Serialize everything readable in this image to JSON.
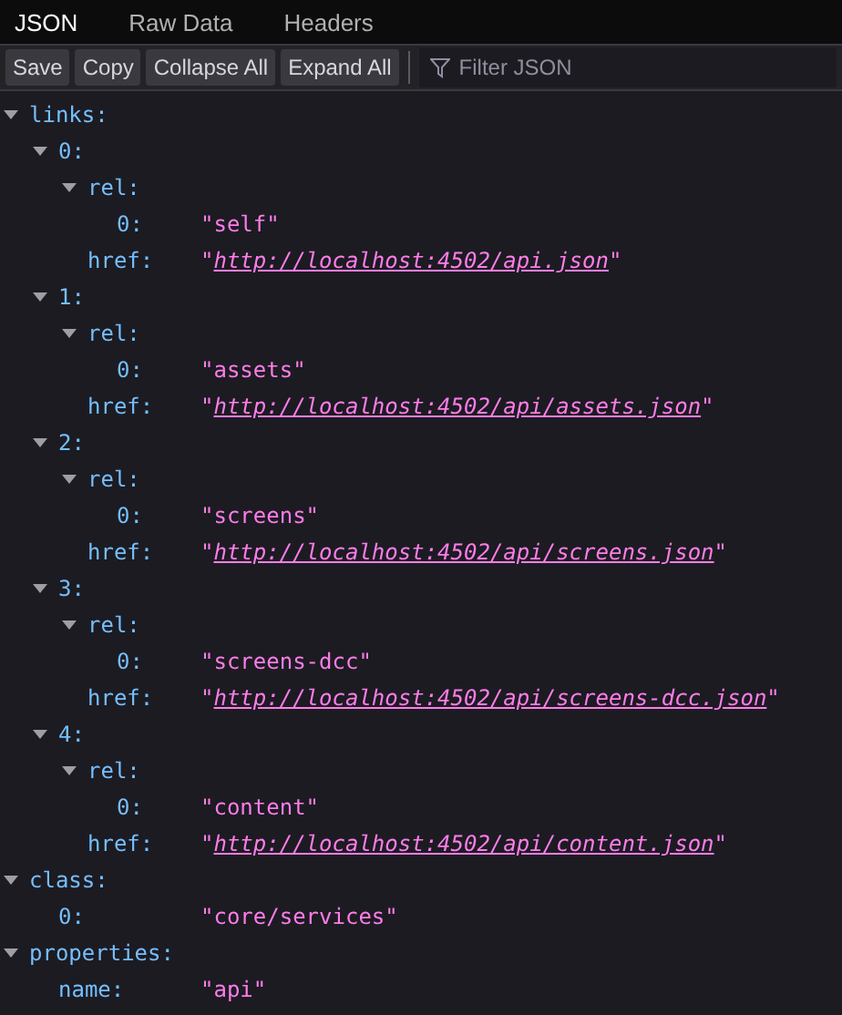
{
  "tabs": [
    {
      "label": "JSON",
      "selected": true
    },
    {
      "label": "Raw Data",
      "selected": false
    },
    {
      "label": "Headers",
      "selected": false
    }
  ],
  "toolbar": {
    "buttons": [
      "Save",
      "Copy",
      "Collapse All",
      "Expand All"
    ],
    "filter": {
      "placeholder": "Filter JSON"
    }
  },
  "tree": [
    {
      "key": "links:",
      "expanded": true,
      "children": [
        {
          "key": "0:",
          "expanded": true,
          "children": [
            {
              "key": "rel:",
              "expanded": true,
              "children": [
                {
                  "key": "0:",
                  "kind": "string",
                  "value": "\"self\""
                }
              ]
            },
            {
              "key": "href:",
              "kind": "link",
              "before": "\"",
              "link": "http://localhost:4502/api.json",
              "after": "\""
            }
          ]
        },
        {
          "key": "1:",
          "expanded": true,
          "children": [
            {
              "key": "rel:",
              "expanded": true,
              "children": [
                {
                  "key": "0:",
                  "kind": "string",
                  "value": "\"assets\""
                }
              ]
            },
            {
              "key": "href:",
              "kind": "link",
              "before": "\"",
              "link": "http://localhost:4502/api/assets.json",
              "after": "\""
            }
          ]
        },
        {
          "key": "2:",
          "expanded": true,
          "children": [
            {
              "key": "rel:",
              "expanded": true,
              "children": [
                {
                  "key": "0:",
                  "kind": "string",
                  "value": "\"screens\""
                }
              ]
            },
            {
              "key": "href:",
              "kind": "link",
              "before": "\"",
              "link": "http://localhost:4502/api/screens.json",
              "after": "\""
            }
          ]
        },
        {
          "key": "3:",
          "expanded": true,
          "children": [
            {
              "key": "rel:",
              "expanded": true,
              "children": [
                {
                  "key": "0:",
                  "kind": "string",
                  "value": "\"screens-dcc\""
                }
              ]
            },
            {
              "key": "href:",
              "kind": "link",
              "before": "\"",
              "link": "http://localhost:4502/api/screens-dcc.json",
              "after": "\""
            }
          ]
        },
        {
          "key": "4:",
          "expanded": true,
          "children": [
            {
              "key": "rel:",
              "expanded": true,
              "children": [
                {
                  "key": "0:",
                  "kind": "string",
                  "value": "\"content\""
                }
              ]
            },
            {
              "key": "href:",
              "kind": "link",
              "before": "\"",
              "link": "http://localhost:4502/api/content.json",
              "after": "\""
            }
          ]
        }
      ]
    },
    {
      "key": "class:",
      "expanded": true,
      "children": [
        {
          "key": "0:",
          "kind": "string",
          "value": "\"core/services\""
        }
      ]
    },
    {
      "key": "properties:",
      "expanded": true,
      "children": [
        {
          "key": "name:",
          "kind": "string",
          "value": "\"api\""
        }
      ]
    }
  ]
}
